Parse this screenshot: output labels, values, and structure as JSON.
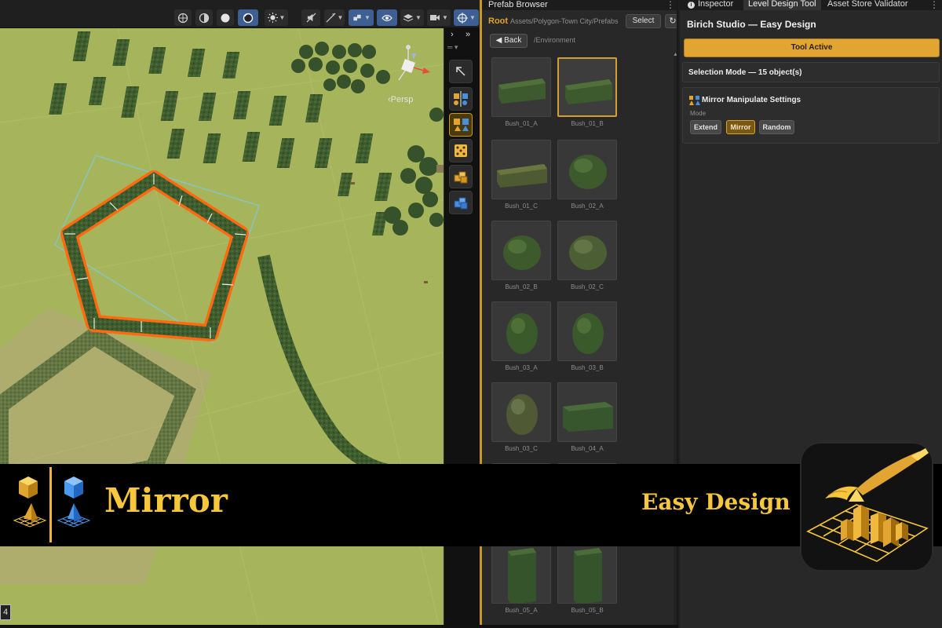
{
  "scene": {
    "toolbar_icons": [
      "grid-icon",
      "shading-globe-icon",
      "wireframe-circle-icon",
      "lit-sphere-icon",
      "lighting-icon",
      "audio-mute-icon",
      "effects-icon",
      "scene-visibility-icon",
      "eye-icon",
      "layers-icon",
      "camera-icon",
      "gizmos-icon"
    ],
    "persp_label": "‹Persp",
    "status_number": "4",
    "tool_icons": [
      "arrow-icon",
      "mirror-cubes-icon",
      "mirror-manipulate-icon",
      "random-dice-icon",
      "extend-cubes-icon",
      "blue-cubes-icon"
    ]
  },
  "prefab_browser": {
    "tab_title": "Prefab Browser",
    "root_label": "Root",
    "path": "Assets/Polygon-Town City/Prefabs",
    "select_label": "Select",
    "refresh_glyph": "↻",
    "back_label": "Back",
    "current_folder": "/Environment",
    "items": [
      {
        "label": "Bush_01_A",
        "kind": "box",
        "selected": false
      },
      {
        "label": "Bush_01_B",
        "kind": "box",
        "selected": true
      },
      {
        "label": "Bush_01_C",
        "kind": "box-olive",
        "selected": false
      },
      {
        "label": "Bush_02_A",
        "kind": "round",
        "selected": false
      },
      {
        "label": "Bush_02_B",
        "kind": "round",
        "selected": false
      },
      {
        "label": "Bush_02_C",
        "kind": "round-olive",
        "selected": false
      },
      {
        "label": "Bush_03_A",
        "kind": "oval",
        "selected": false
      },
      {
        "label": "Bush_03_B",
        "kind": "oval",
        "selected": false
      },
      {
        "label": "Bush_03_C",
        "kind": "oval-olive",
        "selected": false
      },
      {
        "label": "Bush_04_A",
        "kind": "wide-box",
        "selected": false
      },
      {
        "label": "",
        "kind": "empty",
        "selected": false
      },
      {
        "label": "",
        "kind": "empty",
        "selected": false
      },
      {
        "label": "Bush_05_A",
        "kind": "tall",
        "selected": false
      },
      {
        "label": "Bush_05_B",
        "kind": "tall",
        "selected": false
      }
    ]
  },
  "inspector": {
    "tabs": [
      "Inspector",
      "Level Design Tool",
      "Asset Store Validator"
    ],
    "active_tab": 1,
    "title": "Birich Studio — Easy Design",
    "tool_active_label": "Tool Active",
    "selection_mode": "Selection Mode — 15 object(s)",
    "mirror_title": "Mirror Manipulate Settings",
    "mode_label": "Mode",
    "modes": [
      "Extend",
      "Mirror",
      "Random"
    ],
    "active_mode": "Mirror"
  },
  "banner": {
    "title": "Mirror",
    "subtitle": "Easy Design",
    "accent": "#f6c63c"
  },
  "colors": {
    "accent": "#e2a531",
    "ground": "#a5b35a",
    "hedge": "#3b5a2c",
    "selection": "#ff6a10"
  }
}
